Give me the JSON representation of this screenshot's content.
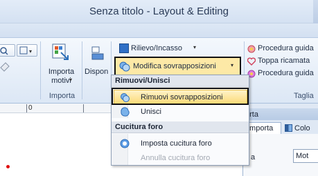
{
  "window": {
    "title": "Senza titolo - Layout & Editing"
  },
  "ribbon": {
    "import_group": {
      "button_label_line1": "Importa",
      "button_label_line2": "motivi",
      "group_label": "Importa"
    },
    "arrange_button": "Dispon",
    "relief_button": "Rilievo/Incasso",
    "edit_overlaps_button": "Modifica sovrapposizioni",
    "right_items": [
      "Procedura guida",
      "Toppa ricamata",
      "Procedura guida"
    ],
    "right_group_label": "Taglia"
  },
  "menu": {
    "section_remove_merge": "Rimuovi/Unisci",
    "remove_overlaps": "Rimuovi sovrapposizioni",
    "merge": "Unisci",
    "section_hole_stitch": "Cucitura foro",
    "set_hole_stitch": "Imposta cucitura foro",
    "cancel_hole_stitch": "Annulla cucitura foro"
  },
  "ruler": {
    "mark": "0"
  },
  "right_pane": {
    "title": "orta",
    "tab_import": "Importa",
    "tab_color": "Colo",
    "field_label": "a",
    "field_value": "Mot"
  },
  "colors": {
    "accent_highlight": "#fbe08f",
    "selection_frame": "#111111"
  }
}
